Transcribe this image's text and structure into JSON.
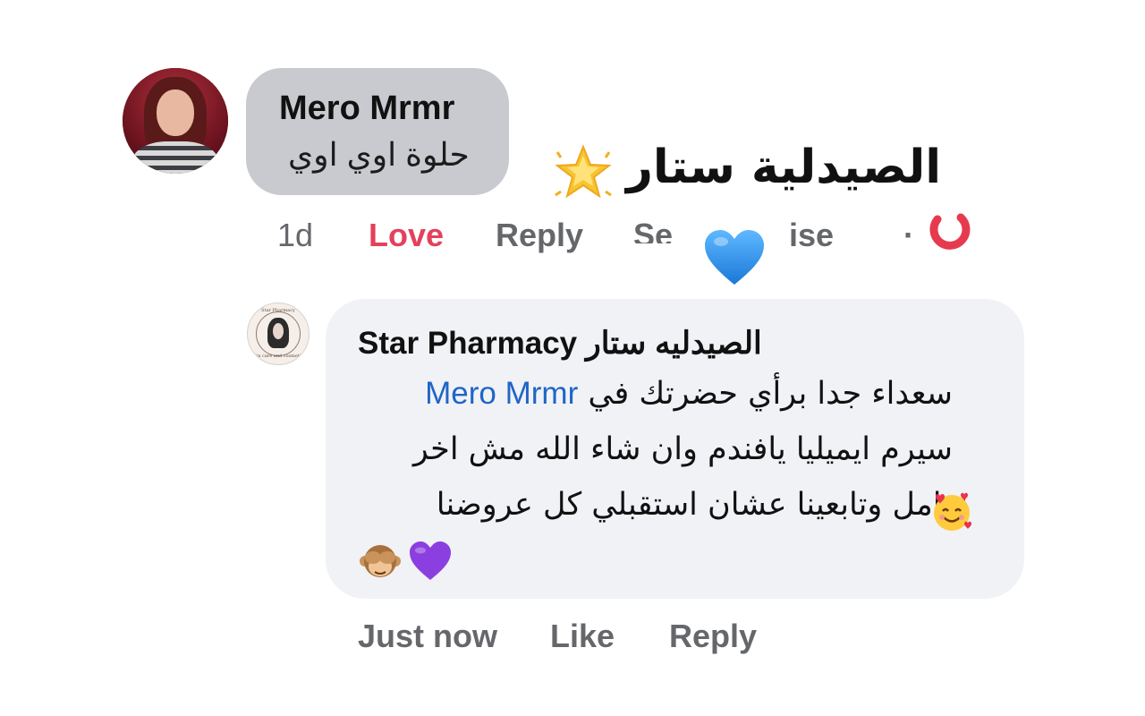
{
  "comment": {
    "author": "Mero Mrmr",
    "text": "حلوة اوي اوي",
    "time": "1d",
    "actions": {
      "love": "Love",
      "reply": "Reply",
      "see": "Se",
      "lose": "ise"
    }
  },
  "overlay": {
    "title": "الصيدلية ستار",
    "star_icon": "star-icon",
    "ring_icon": "red-ring-icon",
    "sticker_icon": "blue-heart-icon"
  },
  "reply": {
    "author": "الصيدليه ستار Star Pharmacy",
    "mention": "Mero Mrmr",
    "line1": "سعداء جدا برأي حضرتك في",
    "line2": "سيرم ايميليا يافندم وان شاء الله مش اخر",
    "line3": "تعامل وتابعينا عشان استقبلي كل عروضنا",
    "emoji_line3": "smiling-face-with-hearts-icon",
    "emoji_line4": [
      "see-no-evil-monkey-icon",
      "purple-heart-icon"
    ],
    "time": "Just now",
    "like": "Like",
    "reply_label": "Reply",
    "avatar_text_top": "Star Pharmacy",
    "avatar_text_bottom": "Skin care and cosmetics"
  },
  "colors": {
    "bubble_gray": "#c8cacf",
    "bubble_light": "#f0f2f5",
    "love_red": "#e4415b",
    "mention_blue": "#1f65c7",
    "meta_gray": "#65676b"
  }
}
